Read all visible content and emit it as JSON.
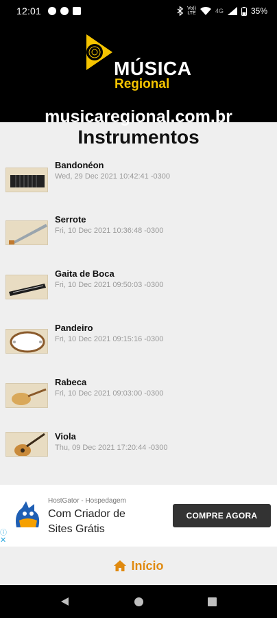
{
  "status": {
    "time": "12:01",
    "net_top": "Vo))",
    "net_bottom": "LTE",
    "four_g": "4G",
    "battery": "35%"
  },
  "header": {
    "logo_title": "MÚSICA",
    "logo_sub": "Regional",
    "domain": "musicaregional.com.br"
  },
  "section_title": "Instrumentos",
  "items": [
    {
      "title": "Bandonéon",
      "date": "Wed, 29 Dec 2021 10:42:41 -0300"
    },
    {
      "title": "Serrote",
      "date": "Fri, 10 Dec 2021 10:36:48 -0300"
    },
    {
      "title": "Gaita de Boca",
      "date": "Fri, 10 Dec 2021 09:50:03 -0300"
    },
    {
      "title": "Pandeiro",
      "date": "Fri, 10 Dec 2021 09:15:16 -0300"
    },
    {
      "title": "Rabeca",
      "date": "Fri, 10 Dec 2021 09:03:00 -0300"
    },
    {
      "title": "Viola",
      "date": "Thu, 09 Dec 2021 17:20:44 -0300"
    }
  ],
  "ad": {
    "brand": "HostGator - Hospedagem",
    "text": "Com Criador de Sites Grátis",
    "cta": "COMPRE AGORA"
  },
  "home_label": "Início",
  "colors": {
    "accent": "#e08a10",
    "logo_yellow": "#f5c400",
    "ad_link": "#2aa7de"
  }
}
